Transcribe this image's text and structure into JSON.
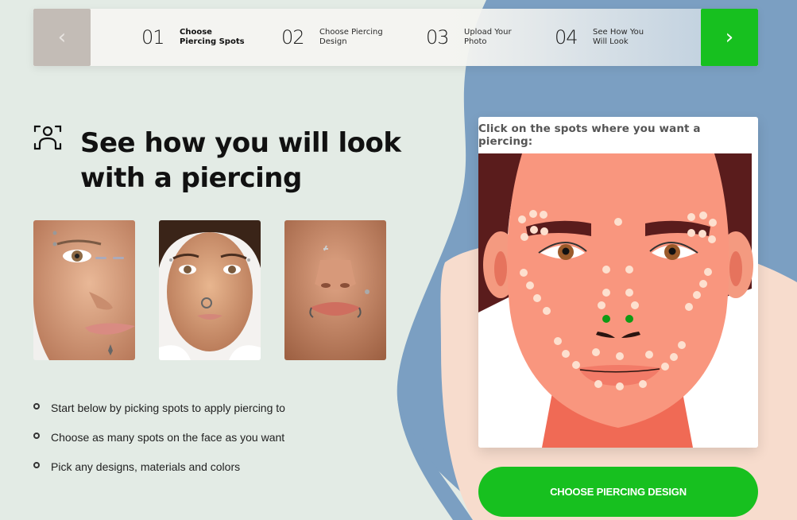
{
  "stepper": {
    "prev_icon": "chevron-left-icon",
    "next_icon": "chevron-right-icon",
    "prev_glyph": "‹",
    "next_glyph": "›",
    "steps": [
      {
        "number": "01",
        "label_line1": "Choose",
        "label_line2": "Piercing Spots",
        "active": true
      },
      {
        "number": "02",
        "label_line1": "Choose Piercing",
        "label_line2": "Design",
        "active": false
      },
      {
        "number": "03",
        "label_line1": "Upload Your",
        "label_line2": "Photo",
        "active": false
      },
      {
        "number": "04",
        "label_line1": "See How You",
        "label_line2": "Will Look",
        "active": false
      }
    ]
  },
  "hero": {
    "icon": "face-scan-icon",
    "title_line1": "See how you will look",
    "title_line2": "with a piercing"
  },
  "examples": [
    {
      "name": "eyebrow-bridge-lip-piercing-example"
    },
    {
      "name": "eyebrow-septum-piercing-example"
    },
    {
      "name": "nose-lip-ring-piercing-example"
    }
  ],
  "bullets": [
    "Start below by picking spots to apply piercing to",
    "Choose as many spots on the face as you want",
    "Pick any designs, materials and colors"
  ],
  "picker": {
    "title": "Click on the spots where you want a piercing:",
    "selected_spots": [
      "nostril-left",
      "nostril-right"
    ],
    "spot_color": "#fde0cf",
    "selected_color": "#0f9a14"
  },
  "cta": {
    "label": "CHOOSE PIERCING DESIGN"
  },
  "colors": {
    "accent_green": "#17c01f",
    "background": "#e3ebe5",
    "blob_blue": "#7b9fc2",
    "blob_peach": "#f7dccd"
  }
}
